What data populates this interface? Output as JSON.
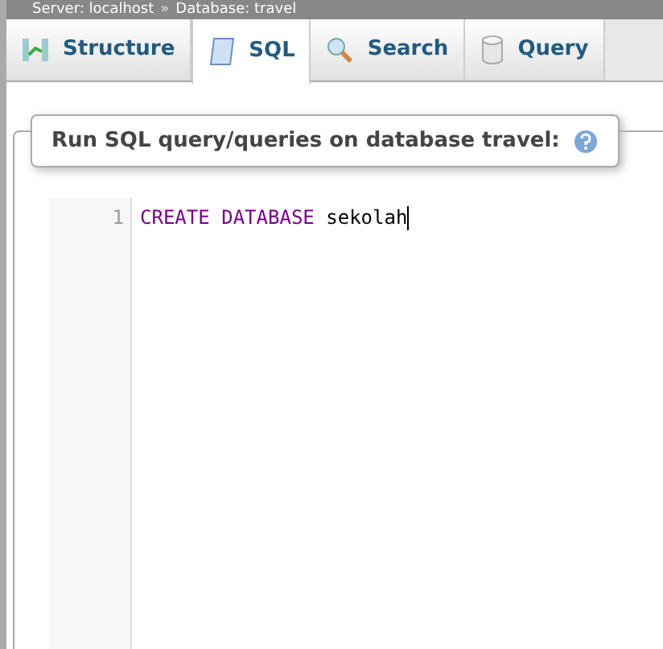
{
  "breadcrumb": [
    {
      "label": "Server: localhost"
    },
    {
      "label": "»",
      "kind": "separator"
    },
    {
      "label": "Database: travel"
    }
  ],
  "tabs": [
    {
      "label": "Structure",
      "kind": "structure",
      "selected": false
    },
    {
      "label": "SQL",
      "kind": "sql",
      "selected": true
    },
    {
      "label": "Search",
      "kind": "search",
      "selected": false
    },
    {
      "label": "Query",
      "kind": "query",
      "selected": false
    }
  ],
  "legend": {
    "text": "Run SQL query/queries on database travel:"
  },
  "editor": {
    "lines": [
      {
        "number": "1",
        "tokens": [
          {
            "text": "CREATE",
            "kind": "keyword"
          },
          {
            "text": "DATABASE",
            "kind": "keyword"
          },
          {
            "text": "sekolah",
            "kind": "plain"
          }
        ]
      }
    ]
  }
}
